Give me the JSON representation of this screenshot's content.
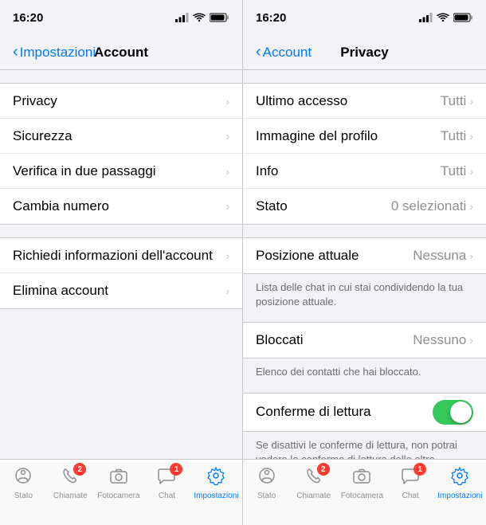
{
  "left_panel": {
    "status_bar": {
      "time": "16:20",
      "signal_icon": "signal",
      "wifi_icon": "wifi",
      "battery_icon": "battery",
      "location_icon": "location-arrow"
    },
    "nav": {
      "back_label": "Impostazioni",
      "title": "Account"
    },
    "sections": [
      {
        "id": "account-settings",
        "items": [
          {
            "label": "Privacy",
            "value": ""
          },
          {
            "label": "Sicurezza",
            "value": ""
          },
          {
            "label": "Verifica in due passaggi",
            "value": ""
          },
          {
            "label": "Cambia numero",
            "value": ""
          }
        ]
      },
      {
        "id": "account-actions",
        "items": [
          {
            "label": "Richiedi informazioni dell'account",
            "value": ""
          },
          {
            "label": "Elimina account",
            "value": ""
          }
        ]
      }
    ]
  },
  "right_panel": {
    "status_bar": {
      "time": "16:20"
    },
    "nav": {
      "back_label": "Account",
      "title": "Privacy"
    },
    "sections": [
      {
        "id": "privacy-main",
        "items": [
          {
            "label": "Ultimo accesso",
            "value": "Tutti"
          },
          {
            "label": "Immagine del profilo",
            "value": "Tutti"
          },
          {
            "label": "Info",
            "value": "Tutti"
          },
          {
            "label": "Stato",
            "value": "0 selezionati"
          }
        ]
      },
      {
        "id": "position",
        "items": [
          {
            "label": "Posizione attuale",
            "value": "Nessuna"
          }
        ],
        "footer": "Lista delle chat in cui stai condividendo la tua posizione attuale."
      },
      {
        "id": "blocked",
        "items": [
          {
            "label": "Bloccati",
            "value": "Nessuno"
          }
        ],
        "footer": "Elenco dei contatti che hai bloccato."
      },
      {
        "id": "read-receipts",
        "toggle_item": {
          "label": "Conferme di lettura",
          "enabled": true
        },
        "footer": "Se disattivi le conferme di lettura, non potrai vedere le conferme di lettura delle altre persone. Le conferme di lettura vengono sempre inviate per le chat di gruppo."
      }
    ]
  },
  "tab_bar": {
    "items": [
      {
        "id": "stato",
        "label": "Stato",
        "icon": "circle",
        "badge": null,
        "active": false
      },
      {
        "id": "chiamate",
        "label": "Chiamate",
        "icon": "phone",
        "badge": "2",
        "active": false
      },
      {
        "id": "fotocamera",
        "label": "Fotocamera",
        "icon": "camera",
        "badge": null,
        "active": false
      },
      {
        "id": "chat",
        "label": "Chat",
        "icon": "message",
        "badge": "1",
        "active": false
      },
      {
        "id": "impostazioni",
        "label": "Impostazioni",
        "icon": "gear",
        "badge": null,
        "active": true
      }
    ]
  },
  "tab_bar_right": {
    "items": [
      {
        "id": "stato",
        "label": "Stato",
        "icon": "circle",
        "badge": null,
        "active": false
      },
      {
        "id": "chiamate",
        "label": "Chiamate",
        "icon": "phone",
        "badge": "2",
        "active": false
      },
      {
        "id": "fotocamera",
        "label": "Fotocamera",
        "icon": "camera",
        "badge": null,
        "active": false
      },
      {
        "id": "chat",
        "label": "Chat",
        "icon": "message",
        "badge": "1",
        "active": false
      },
      {
        "id": "impostazioni",
        "label": "Impostazioni",
        "icon": "gear",
        "badge": null,
        "active": true
      }
    ]
  }
}
